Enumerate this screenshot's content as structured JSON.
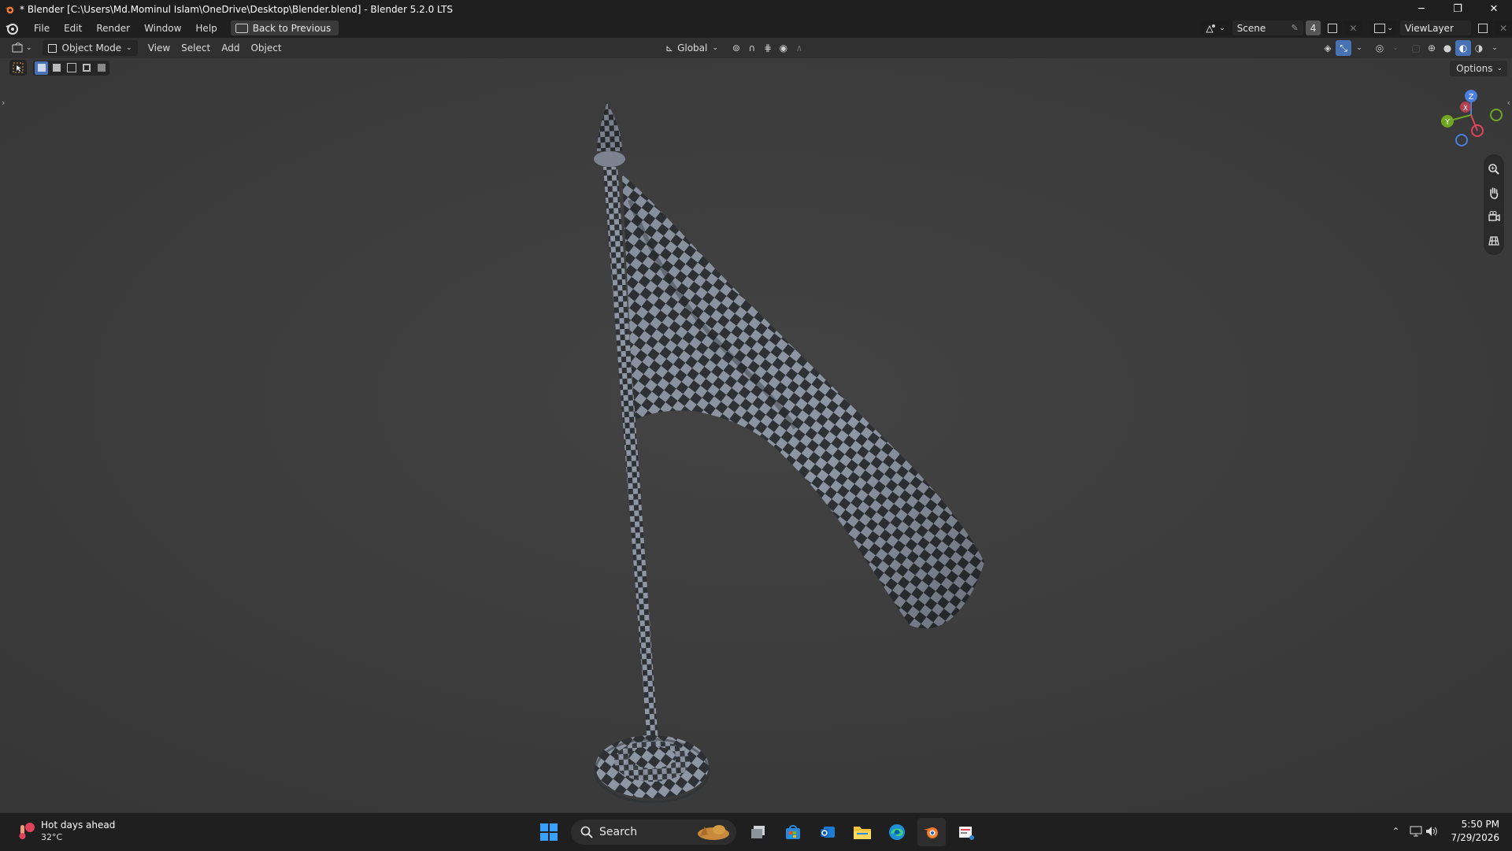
{
  "window": {
    "title": "* Blender [C:\\Users\\Md.Mominul Islam\\OneDrive\\Desktop\\Blender.blend] - Blender 5.2.0 LTS",
    "controls": {
      "minimize": "─",
      "restore": "❐",
      "close": "✕"
    }
  },
  "menubar": {
    "items": [
      "File",
      "Edit",
      "Render",
      "Window",
      "Help"
    ],
    "back_button": "Back to Previous",
    "scene_label": "Scene",
    "scene_users": "4",
    "view_layer_label": "ViewLayer"
  },
  "header": {
    "mode": "Object Mode",
    "menus": [
      "View",
      "Select",
      "Add",
      "Object"
    ],
    "transform_orientation": "Global",
    "options": "Options"
  },
  "gizmo": {
    "z": "Z",
    "y": "Y",
    "x": "X"
  },
  "taskbar": {
    "weather_title": "Hot days ahead",
    "weather_temp": "32°C",
    "search_placeholder": "Search",
    "time": "5:50 PM",
    "date": "7/29/2026"
  },
  "colors": {
    "accent": "#4772b3",
    "viewport_bg": "#3d3d3d",
    "header_bg": "#303030",
    "checker_dark": "#2e3236",
    "checker_light": "#8e95a3"
  },
  "icons": [
    "blender-logo-icon",
    "editor-type-icon",
    "object-mode-icon",
    "gizmo-axes",
    "zoom-icon",
    "pan-hand-icon",
    "camera-icon",
    "grid-ortho-icon",
    "windows-start-icon",
    "search-icon",
    "edge-icon",
    "file-explorer-icon",
    "store-icon",
    "outlook-icon"
  ]
}
